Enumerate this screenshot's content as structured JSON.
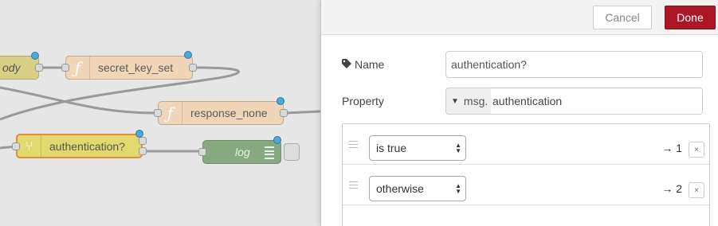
{
  "workspace": {
    "nodes": [
      {
        "id": "body",
        "label": "ody",
        "type": "body"
      },
      {
        "id": "secret",
        "label": "secret_key_set",
        "type": "function"
      },
      {
        "id": "response",
        "label": "response_none",
        "type": "function"
      },
      {
        "id": "auth",
        "label": "authentication?",
        "type": "switch"
      },
      {
        "id": "log",
        "label": "log",
        "type": "debug"
      }
    ]
  },
  "tray": {
    "cancel_label": "Cancel",
    "done_label": "Done",
    "name_label": "Name",
    "name_value": "authentication?",
    "property_label": "Property",
    "property_type": "msg.",
    "property_value": "authentication",
    "rules": [
      {
        "operator": "is true",
        "output": "→ 1",
        "remove": "×"
      },
      {
        "operator": "otherwise",
        "output": "→ 2",
        "remove": "×"
      }
    ]
  },
  "colors": {
    "done_button": "#ad1625",
    "function_node": "#f1d5b8",
    "switch_node": "#e2d96e",
    "debug_node": "#87a980",
    "port_changed_dot": "#4ba8d8"
  }
}
